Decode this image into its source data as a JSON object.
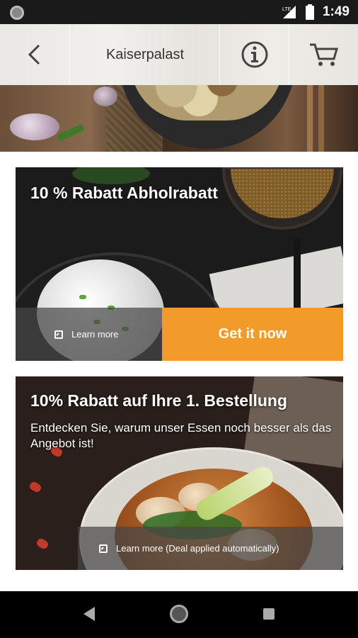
{
  "status_bar": {
    "time": "1:49",
    "network": "LTE"
  },
  "header": {
    "title": "Kaiserpalast",
    "back_icon": "chevron-left-icon",
    "info_icon": "info-circle-icon",
    "cart_icon": "shopping-cart-icon"
  },
  "deals": [
    {
      "title": "10 % Rabatt Abholrabatt",
      "learn_more": "Learn more",
      "cta": "Get it now"
    },
    {
      "title": "10% Rabatt auf Ihre 1. Bestellung",
      "description": "Entdecken Sie, warum unser Essen noch besser als das Angebot ist!",
      "learn_more": "Learn more (Deal applied automatically)"
    }
  ],
  "colors": {
    "accent": "#f29b2a",
    "status_bar": "#1a1a1a",
    "nav_bar": "#000000"
  }
}
